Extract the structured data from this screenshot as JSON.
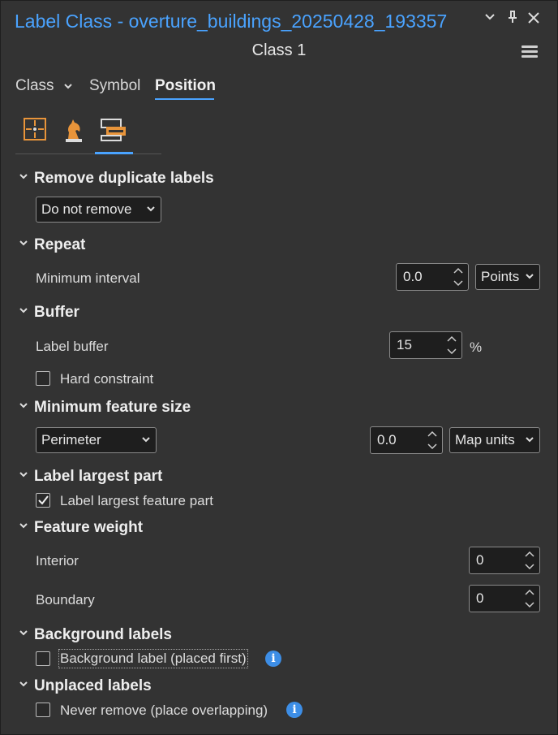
{
  "window": {
    "title": "Label Class - overture_buildings_20250428_193357",
    "subtitle": "Class 1",
    "icons": [
      "chevron-down-icon",
      "pin-icon",
      "close-icon",
      "menu-icon"
    ]
  },
  "tabs": [
    {
      "label": "Class",
      "active": false
    },
    {
      "label": "Symbol",
      "active": false
    },
    {
      "label": "Position",
      "active": true
    }
  ],
  "subtabs": [
    {
      "icon": "placement-icon",
      "active": false
    },
    {
      "icon": "chess-knight-icon",
      "active": false
    },
    {
      "icon": "conflict-resolution-icon",
      "active": true
    }
  ],
  "sections": {
    "remove_duplicates": {
      "title": "Remove duplicate labels",
      "value": "Do not remove"
    },
    "repeat": {
      "title": "Repeat",
      "label": "Minimum interval",
      "value": "0.0",
      "unit": "Points"
    },
    "buffer": {
      "title": "Buffer",
      "label": "Label buffer",
      "value": "15",
      "unit": "%",
      "hard_constraint": "Hard constraint",
      "hard_constraint_checked": false
    },
    "min_feature_size": {
      "title": "Minimum feature size",
      "mode": "Perimeter",
      "value": "0.0",
      "unit": "Map units"
    },
    "largest_part": {
      "title": "Label largest part",
      "checkbox": "Label largest feature part",
      "checked": true
    },
    "feature_weight": {
      "title": "Feature weight",
      "interior_label": "Interior",
      "interior_value": "0",
      "boundary_label": "Boundary",
      "boundary_value": "0"
    },
    "background": {
      "title": "Background labels",
      "checkbox": "Background label (placed first)",
      "checked": false
    },
    "unplaced": {
      "title": "Unplaced labels",
      "checkbox": "Never remove (place overlapping)",
      "checked": false
    }
  },
  "colors": {
    "accent": "#4aa3ff",
    "background": "#333333",
    "info": "#3d8ee6",
    "icon_orange": "#e8943a"
  }
}
